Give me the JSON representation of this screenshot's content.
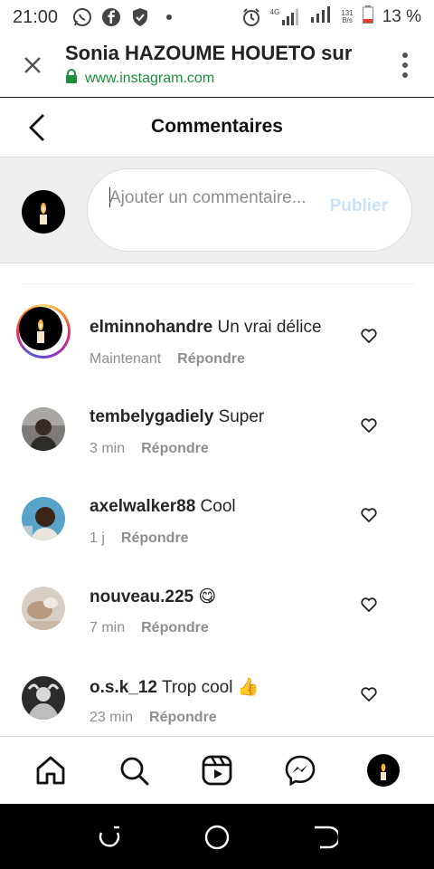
{
  "status_bar": {
    "time": "21:00",
    "battery_text": "13 %",
    "net_speed_top": "131",
    "net_speed_bottom": "B/s",
    "network_type": "4G"
  },
  "browser": {
    "title": "Sonia HAZOUME HOUETO sur",
    "url": "www.instagram.com"
  },
  "header": {
    "title": "Commentaires"
  },
  "compose": {
    "placeholder": "Ajouter un commentaire...",
    "publish_label": "Publier"
  },
  "comments": [
    {
      "user": "elminnohandre",
      "text": "Un vrai délice",
      "time": "Maintenant",
      "reply": "Répondre"
    },
    {
      "user": "tembelygadiely",
      "text": "Super",
      "time": "3 min",
      "reply": "Répondre"
    },
    {
      "user": "axelwalker88",
      "text": "Cool",
      "time": "1 j",
      "reply": "Répondre"
    },
    {
      "user": "nouveau.225",
      "text": "😋",
      "time": "7 min",
      "reply": "Répondre"
    },
    {
      "user": "o.s.k_12",
      "text": "Trop cool 👍",
      "time": "23 min",
      "reply": "Répondre"
    }
  ],
  "colors": {
    "link_green": "#1e8e3e",
    "publish_disabled": "#c9e3fb",
    "meta_gray": "#8e8e8e"
  },
  "icons": {
    "nav": [
      "home-icon",
      "search-icon",
      "reels-icon",
      "messenger-icon",
      "profile-avatar"
    ]
  }
}
